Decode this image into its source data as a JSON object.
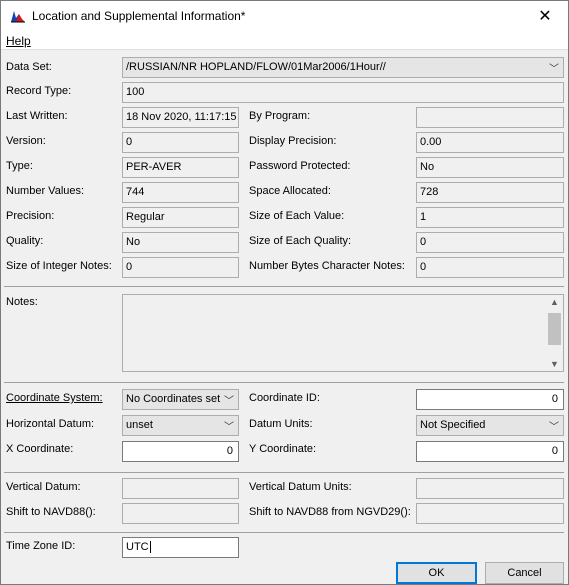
{
  "window": {
    "title": "Location and Supplemental Information*",
    "close_glyph": "✕"
  },
  "menu": {
    "help": "Help"
  },
  "labels": {
    "data_set": "Data Set:",
    "record_type": "Record Type:",
    "last_written": "Last Written:",
    "by_program": "By Program:",
    "version": "Version:",
    "display_precision": "Display Precision:",
    "type": "Type:",
    "password_protected": "Password Protected:",
    "number_values": "Number Values:",
    "space_allocated": "Space Allocated:",
    "precision": "Precision:",
    "size_each_value": "Size of Each Value:",
    "quality": "Quality:",
    "size_each_quality": "Size of Each Quality:",
    "size_integer_notes": "Size of Integer Notes:",
    "number_bytes_char_notes": "Number Bytes Character Notes:",
    "notes": "Notes:",
    "coordinate_system": "Coordinate System:",
    "coordinate_id": "Coordinate ID:",
    "horizontal_datum": "Horizontal Datum:",
    "datum_units": "Datum Units:",
    "x_coordinate": "X Coordinate:",
    "y_coordinate": "Y Coordinate:",
    "vertical_datum": "Vertical Datum:",
    "vertical_datum_units": "Vertical Datum Units:",
    "shift_navd88": "Shift to NAVD88():",
    "shift_navd88_ngvd29": "Shift to NAVD88 from NGVD29():",
    "time_zone_id": "Time Zone ID:"
  },
  "values": {
    "data_set": "/RUSSIAN/NR HOPLAND/FLOW/01Mar2006/1Hour//",
    "record_type": "100",
    "last_written": "18 Nov 2020, 11:17:15",
    "by_program": "",
    "version": "0",
    "display_precision": "0.00",
    "type": "PER-AVER",
    "password_protected": "No",
    "number_values": "744",
    "space_allocated": "728",
    "precision": "Regular",
    "size_each_value": "1",
    "quality": "No",
    "size_each_quality": "0",
    "size_integer_notes": "0",
    "number_bytes_char_notes": "0",
    "notes": "",
    "coordinate_system": "No Coordinates set",
    "coordinate_id": "0",
    "horizontal_datum": "unset",
    "datum_units": "Not Specified",
    "x_coordinate": "0",
    "y_coordinate": "0",
    "vertical_datum": "",
    "vertical_datum_units": "",
    "shift_navd88": "",
    "shift_navd88_ngvd29": "",
    "time_zone_id": "UTC"
  },
  "buttons": {
    "ok": "OK",
    "cancel": "Cancel"
  },
  "icons": {
    "combo_arrow": "﹀",
    "scroll_up": "▲",
    "scroll_down": "▼"
  }
}
